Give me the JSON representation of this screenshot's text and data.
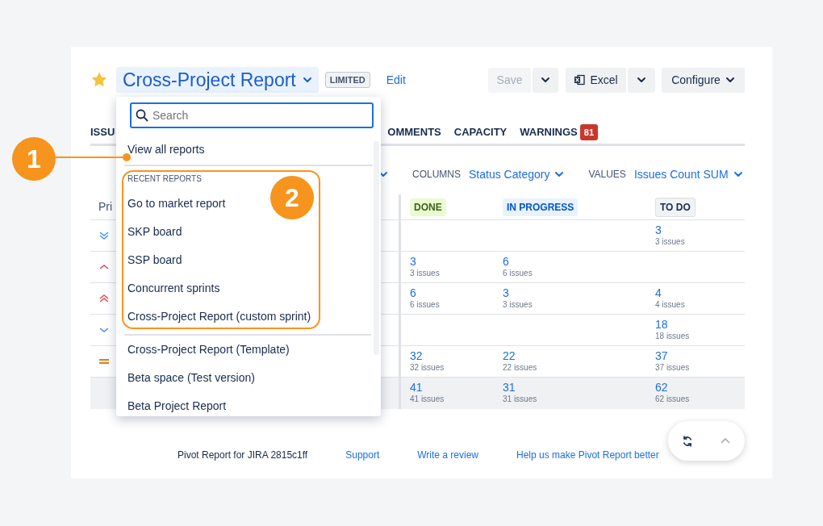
{
  "header": {
    "starred": true,
    "title": "Cross-Project Report",
    "badge": "LIMITED",
    "edit": "Edit",
    "buttons": [
      {
        "kind": "split",
        "label": "Save",
        "disabled": true
      },
      {
        "kind": "split",
        "label": "Excel",
        "disabled": false
      },
      {
        "kind": "menu",
        "label": "Configure",
        "disabled": false
      }
    ]
  },
  "tabs": [
    {
      "label": "ISSU"
    },
    {
      "label": "OMMENTS"
    },
    {
      "label": "CAPACITY"
    },
    {
      "label": "WARNINGS",
      "count": "81"
    }
  ],
  "settings": [
    {
      "label": "COLUMNS",
      "value": "Status Category"
    },
    {
      "label": "VALUES",
      "value": "Issues Count SUM"
    }
  ],
  "table": {
    "columns": [
      {
        "label": "Pri"
      },
      {
        "label": "DONE",
        "color": "#e9fbd1"
      },
      {
        "label": "IN PROGRESS",
        "color": "#e9f2ff"
      },
      {
        "label": "TO DO",
        "color": "#f1f2f4"
      }
    ],
    "rows": [
      {
        "kind": "lowest",
        "cells": [
          "",
          "",
          "",
          {
            "value": "3",
            "sub": "3 issues"
          }
        ]
      },
      {
        "kind": "high",
        "cells": [
          "",
          {
            "value": "3",
            "sub": "3 issues"
          },
          {
            "value": "6",
            "sub": "6 issues"
          },
          ""
        ]
      },
      {
        "kind": "highest",
        "cells": [
          "",
          {
            "value": "6",
            "sub": "6 issues"
          },
          {
            "value": "3",
            "sub": "3 issues"
          },
          {
            "value": "4",
            "sub": "4 issues"
          }
        ]
      },
      {
        "kind": "low",
        "cells": [
          "",
          "",
          "",
          {
            "value": "18",
            "sub": "18 issues"
          }
        ]
      },
      {
        "kind": "medium",
        "cells": [
          "",
          {
            "value": "32",
            "sub": "32 issues"
          },
          {
            "value": "22",
            "sub": "22 issues"
          },
          {
            "value": "37",
            "sub": "37 issues"
          }
        ]
      },
      {
        "kind": "total",
        "cells": [
          "",
          {
            "value": "41",
            "sub": "41 issues"
          },
          {
            "value": "31",
            "sub": "31 issues"
          },
          {
            "value": "62",
            "sub": "62 issues"
          }
        ]
      }
    ]
  },
  "footer": {
    "text": "Pivot Report for JIRA 2815c1ff",
    "links": [
      "Support",
      "Write a review",
      "Help us make Pivot Report better"
    ]
  },
  "dropdown": {
    "search": {
      "placeholder": "Search"
    },
    "view_all": "View all reports",
    "recent": {
      "heading": "RECENT REPORTS",
      "items": [
        "Go to market report",
        "SKP board",
        "SSP board",
        "Concurrent sprints",
        "Cross-Project Report (custom sprint)"
      ]
    },
    "items": [
      "Cross-Project Report (Template)",
      "Beta space (Test version)",
      "Beta Project Report"
    ]
  },
  "callouts": [
    {
      "kind": "pointer",
      "number": "1"
    },
    {
      "kind": "frame",
      "number": "2"
    }
  ]
}
